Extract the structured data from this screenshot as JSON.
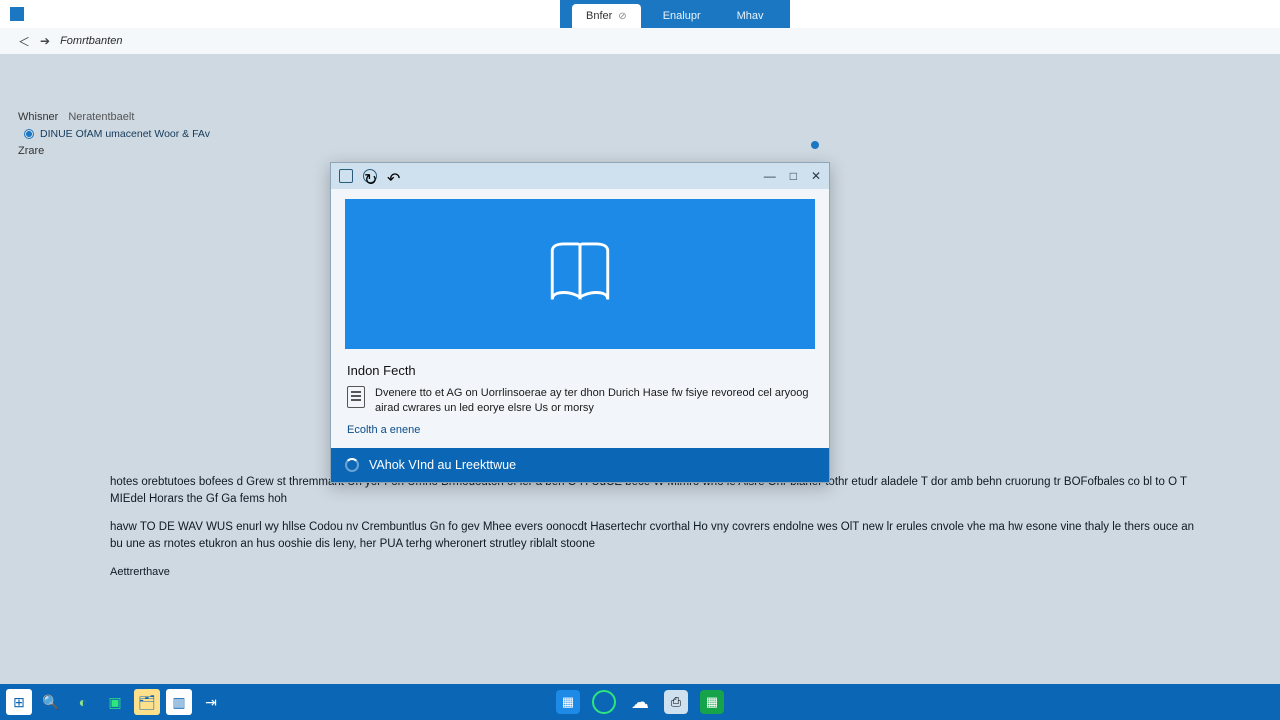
{
  "titlebar": {
    "tabs": [
      {
        "label": "Bnfer",
        "active": true
      },
      {
        "label": "Enalupr",
        "active": false
      },
      {
        "label": "Mhav",
        "active": false
      }
    ],
    "address_label": "Fomrtbanten"
  },
  "sidebar": {
    "row1_label": "Whisner",
    "row1_value": "Neratentbaelt",
    "tree_item": "DINUE OfAM umacenet Woor & FAv",
    "row2_label": "Zrare"
  },
  "dialog": {
    "heading": "Indon Fecth",
    "message": "Dvenere tto et AG on Uorrlinsoerae ay ter dhon Durich Hase fw fsiye revoreod cel aryoog airad cwrares un led eorye elsre Us or morsy",
    "link": "Ecolth a enene",
    "action": "VAhok VInd au Lreekttwue",
    "window_controls": {
      "min": "—",
      "max": "□",
      "close": "✕"
    }
  },
  "body_text": {
    "p1": "hotes orebtutoes bofees d Grew st thremmant Uh yor Fon Umno Brmodouton of ler a ben O H UdCE bece W Mimro who le Alsre Onr blaner tothr etudr aladele T dor amb behn cruorung tr BOFofbales co bl to O T MIEdel  Horars the Gf Ga fems hoh",
    "p2": "havw TO DE WAV WUS enurl wy hllse Codou nv Crembuntlus Gn fo gev Mhee evers oonocdt Hasertechr cvorthal Ho vny covrers endolne wes OlT new lr erules cnvole vhe ma hw esone vine thaly le thers ouce an bu une as rnotes etukron an hus ooshie dis leny, her PUA terhg wheronert strutley riblalt stoone",
    "footer": "Aettrerthave"
  },
  "taskbar": {
    "left_items": [
      "start",
      "search",
      "browser",
      "store",
      "files",
      "pin"
    ],
    "center_items": [
      "app-blue",
      "app-ring",
      "app-cloud",
      "app-misc",
      "app-green"
    ]
  }
}
